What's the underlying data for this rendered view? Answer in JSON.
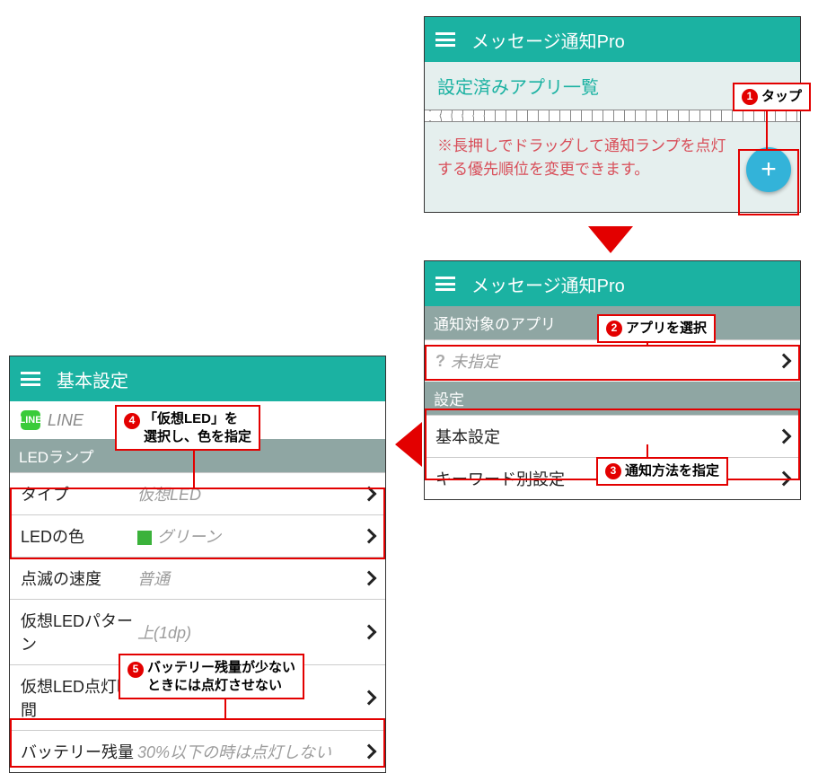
{
  "screen1": {
    "title": "メッセージ通知Pro",
    "subtitle": "設定済みアプリ一覧",
    "note": "※長押しでドラッグして通知ランプを点灯する優先順位を変更できます。",
    "fab_icon": "+"
  },
  "screen2": {
    "title": "メッセージ通知Pro",
    "section1": "通知対象のアプリ",
    "unspecified": "未指定",
    "section2": "設定",
    "item1": "基本設定",
    "item2": "キーワード別設定"
  },
  "screen3": {
    "title": "基本設定",
    "appname": "LINE",
    "section": "LEDランプ",
    "rows": {
      "type_label": "タイプ",
      "type_value": "仮想LED",
      "color_label": "LEDの色",
      "color_value": "グリーン",
      "blink_label": "点滅の速度",
      "blink_value": "普通",
      "pattern_label": "仮想LEDパターン",
      "pattern_value": "上(1dp)",
      "duration_label": "仮想LED点灯時間",
      "duration_value": "",
      "battery_label": "バッテリー残量",
      "battery_value": "30%以下の時は点灯しない"
    }
  },
  "callouts": {
    "c1": "タップ",
    "c2": "アプリを選択",
    "c3": "通知方法を指定",
    "c4a": "「仮想LED」を",
    "c4b": "選択し、色を指定",
    "c5a": "バッテリー残量が少ない",
    "c5b": "ときには点灯させない"
  },
  "nums": {
    "n1": "1",
    "n2": "2",
    "n3": "3",
    "n4": "4",
    "n5": "5"
  }
}
